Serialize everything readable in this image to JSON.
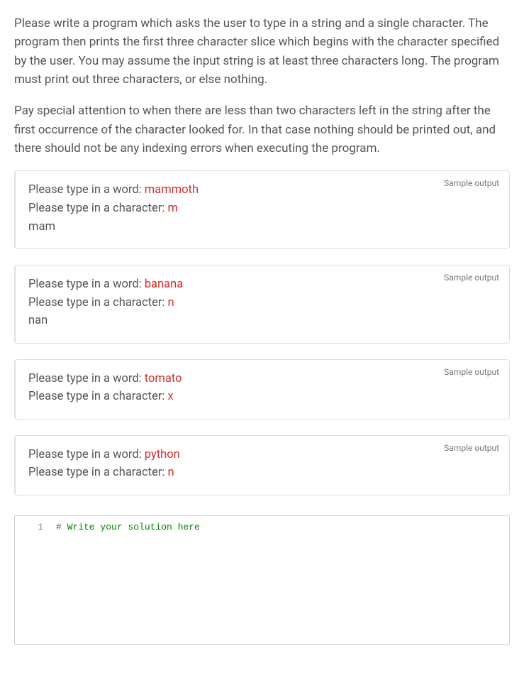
{
  "description": {
    "p1": "Please write a program which asks the user to type in a string and a single character. The program then prints the first three character slice which begins with the character specified by the user. You may assume the input string is at least three characters long. The program must print out three characters, or else nothing.",
    "p2": "Pay special attention to when there are less than two characters left in the string after the first occurrence of the character looked for. In that case nothing should be printed out, and there should not be any indexing errors when executing the program."
  },
  "sample_label": "Sample output",
  "prompts": {
    "word": "Please type in a word: ",
    "char": "Please type in a character: "
  },
  "samples": [
    {
      "word": "mammoth",
      "char": "m",
      "output": "mam"
    },
    {
      "word": "banana",
      "char": "n",
      "output": "nan"
    },
    {
      "word": "tomato",
      "char": "x",
      "output": ""
    },
    {
      "word": "python",
      "char": "n",
      "output": ""
    }
  ],
  "editor": {
    "line_number": "1",
    "comment": "# Write your solution here"
  }
}
